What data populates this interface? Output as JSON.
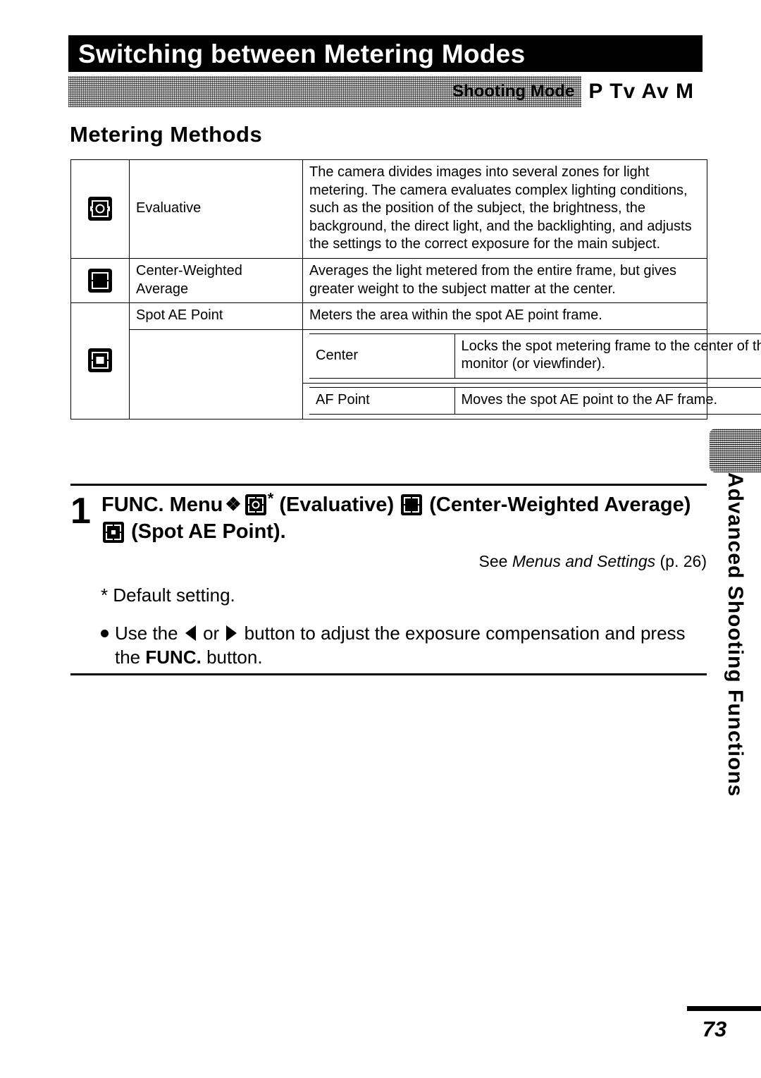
{
  "page": {
    "title": "Switching between Metering Modes",
    "number": "73",
    "side_tab_label": "Advanced Shooting Functions"
  },
  "shooting_mode_strip": {
    "label": "Shooting Mode",
    "modes": "P Tv Av M"
  },
  "section": {
    "heading": "Metering Methods"
  },
  "table": {
    "rows": [
      {
        "icon": "evaluative-metering-icon",
        "name": "Evaluative",
        "description": "The camera divides images into several zones for light metering. The camera evaluates complex lighting conditions, such as the position of the subject, the brightness, the background, the direct light, and the backlighting, and adjusts the settings to the correct exposure for the main subject."
      },
      {
        "icon": "center-weighted-average-metering-icon",
        "name": "Center-Weighted Average",
        "description": "Averages the light metered from the entire frame, but gives greater weight to the subject matter at the center."
      },
      {
        "icon": "spot-ae-point-metering-icon",
        "name": "Spot AE Point",
        "description": "Meters the area within the spot AE point frame.",
        "sub_rows": [
          {
            "name": "Center",
            "description": "Locks the spot metering frame to the center of the LCD monitor (or viewfinder)."
          },
          {
            "name": "AF Point",
            "description": "Moves the spot AE point to the AF frame."
          }
        ]
      }
    ]
  },
  "step": {
    "number": "1",
    "text_part_1": "FUNC. Menu",
    "arrow": "❖",
    "star": "*",
    "text_part_2": "(Evaluative)",
    "text_part_3": "(Center-Weighted Average)",
    "text_part_4": "(Spot AE Point).",
    "see_prefix": "See",
    "see_italic": "Menus and Settings",
    "see_suffix": "(p. 26)"
  },
  "notes": {
    "default_setting": "* Default setting.",
    "bullet_part_1": "Use the",
    "bullet_or": "or",
    "bullet_part_2": "button to adjust the exposure compensation and press the",
    "bullet_bold": "FUNC.",
    "bullet_part_3": "button."
  },
  "colors": {
    "banner_background": "#000000",
    "banner_text": "#ffffff",
    "body_text": "#000000",
    "strip_background": "#c9c9c9",
    "page_background": "#ffffff"
  }
}
